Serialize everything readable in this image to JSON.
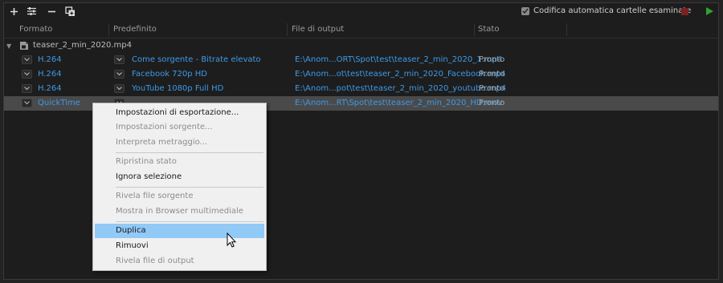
{
  "toolbar": {
    "icons": [
      "add-icon",
      "settings-sliders-icon",
      "remove-icon",
      "duplicate-icon"
    ],
    "auto_encode_label": "Codifica automatica cartelle esaminate",
    "auto_encode_checked": true,
    "stop_color": "#7a2121",
    "start_color": "#2ea32e"
  },
  "columns": {
    "format": "Formato",
    "preset": "Predefinito",
    "output": "File di output",
    "status": "Stato"
  },
  "group": {
    "title": "teaser_2_min_2020.mp4"
  },
  "rows": [
    {
      "format": "H.264",
      "preset": "Come sorgente - Bitrate elevato",
      "output": "E:\\Anom...ORT\\Spot\\test\\teaser_2_min_2020_1.mp4",
      "status": "Pronto"
    },
    {
      "format": "H.264",
      "preset": "Facebook 720p HD",
      "output": "E:\\Anom...ot\\test\\teaser_2_min_2020_Facebook.mp4",
      "status": "Pronto"
    },
    {
      "format": "H.264",
      "preset": "YouTube 1080p Full HD",
      "output": "E:\\Anom...pot\\test\\teaser_2_min_2020_youtube.mp4",
      "status": "Pronto"
    },
    {
      "format": "QuickTime",
      "preset": "",
      "output": "E:\\Anom...RT\\Spot\\test\\teaser_2_min_2020_HD.mov",
      "status": "Pronto"
    }
  ],
  "context_menu": {
    "items": [
      {
        "label": "Impostazioni di esportazione...",
        "enabled": true
      },
      {
        "label": "Impostazioni sorgente...",
        "enabled": false
      },
      {
        "label": "Interpreta metraggio...",
        "enabled": false
      },
      {
        "label": "Ripristina stato",
        "enabled": false
      },
      {
        "label": "Ignora selezione",
        "enabled": true
      },
      {
        "label": "Rivela file sorgente",
        "enabled": false
      },
      {
        "label": "Mostra in Browser multimediale",
        "enabled": false
      },
      {
        "label": "Duplica",
        "enabled": true,
        "highlighted": true
      },
      {
        "label": "Rimuovi",
        "enabled": true
      },
      {
        "label": "Rivela file di output",
        "enabled": false
      }
    ]
  },
  "colors": {
    "link": "#3d9ae8",
    "menu_highlight": "#91c9f7"
  }
}
